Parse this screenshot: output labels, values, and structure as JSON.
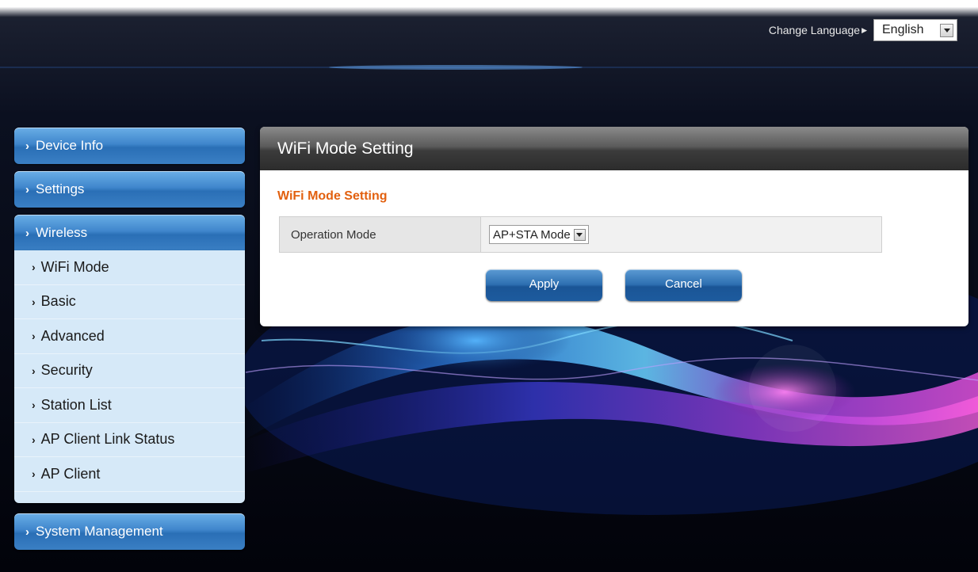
{
  "header": {
    "change_language_label": "Change Language",
    "language_selected": "English"
  },
  "nav": {
    "device_info": "Device Info",
    "settings": "Settings",
    "wireless": "Wireless",
    "system_management": "System Management",
    "wireless_items": [
      {
        "label": "WiFi Mode"
      },
      {
        "label": "Basic"
      },
      {
        "label": "Advanced"
      },
      {
        "label": "Security"
      },
      {
        "label": "Station List"
      },
      {
        "label": "AP Client Link Status"
      },
      {
        "label": "AP Client"
      }
    ]
  },
  "main": {
    "panel_title": "WiFi Mode Setting",
    "section_title": "WiFi Mode Setting",
    "operation_mode_label": "Operation Mode",
    "operation_mode_value": "AP+STA Mode",
    "apply_label": "Apply",
    "cancel_label": "Cancel"
  },
  "colors": {
    "section_title": "#e2600f",
    "nav_blue": "#3f86cc",
    "submenu_bg": "#d6e9f8",
    "panel_header": "#4a4a4a"
  },
  "icons": {
    "nav_chevron": "chevron-right-icon",
    "dropdown": "dropdown-arrow-icon",
    "language_pointer": "triangle-right-icon"
  }
}
